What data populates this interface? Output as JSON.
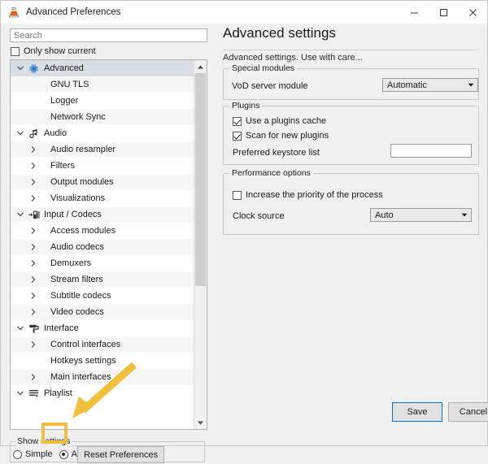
{
  "window": {
    "title": "Advanced Preferences",
    "icon": "vlc-cone-icon",
    "controls": {
      "minimize": "minimize-icon",
      "maximize": "maximize-icon",
      "close": "close-icon"
    }
  },
  "search": {
    "placeholder": "Search",
    "value": ""
  },
  "only_show_current": {
    "label": "Only show current",
    "checked": false
  },
  "tree": {
    "items": [
      {
        "label": "Advanced",
        "indent": 0,
        "icon": "gear-icon",
        "twisty": "expanded",
        "selected": true
      },
      {
        "label": "GNU TLS",
        "indent": 1,
        "icon": "none",
        "twisty": "none"
      },
      {
        "label": "Logger",
        "indent": 1,
        "icon": "none",
        "twisty": "none"
      },
      {
        "label": "Network Sync",
        "indent": 1,
        "icon": "none",
        "twisty": "none"
      },
      {
        "label": "Audio",
        "indent": 0,
        "icon": "music-note-icon",
        "twisty": "expanded"
      },
      {
        "label": "Audio resampler",
        "indent": 1,
        "icon": "none",
        "twisty": "collapsed"
      },
      {
        "label": "Filters",
        "indent": 1,
        "icon": "none",
        "twisty": "collapsed"
      },
      {
        "label": "Output modules",
        "indent": 1,
        "icon": "none",
        "twisty": "collapsed"
      },
      {
        "label": "Visualizations",
        "indent": 1,
        "icon": "none",
        "twisty": "collapsed"
      },
      {
        "label": "Input / Codecs",
        "indent": 0,
        "icon": "input-codecs-icon",
        "twisty": "expanded"
      },
      {
        "label": "Access modules",
        "indent": 1,
        "icon": "none",
        "twisty": "collapsed"
      },
      {
        "label": "Audio codecs",
        "indent": 1,
        "icon": "none",
        "twisty": "collapsed"
      },
      {
        "label": "Demuxers",
        "indent": 1,
        "icon": "none",
        "twisty": "collapsed"
      },
      {
        "label": "Stream filters",
        "indent": 1,
        "icon": "none",
        "twisty": "collapsed"
      },
      {
        "label": "Subtitle codecs",
        "indent": 1,
        "icon": "none",
        "twisty": "collapsed"
      },
      {
        "label": "Video codecs",
        "indent": 1,
        "icon": "none",
        "twisty": "collapsed"
      },
      {
        "label": "Interface",
        "indent": 0,
        "icon": "paint-roller-icon",
        "twisty": "expanded"
      },
      {
        "label": "Control interfaces",
        "indent": 1,
        "icon": "none",
        "twisty": "collapsed"
      },
      {
        "label": "Hotkeys settings",
        "indent": 1,
        "icon": "none",
        "twisty": "none"
      },
      {
        "label": "Main interfaces",
        "indent": 1,
        "icon": "none",
        "twisty": "collapsed"
      },
      {
        "label": "Playlist",
        "indent": 0,
        "icon": "playlist-icon",
        "twisty": "expanded"
      }
    ]
  },
  "scrollbar": {
    "up": "scroll-up-icon",
    "down": "scroll-down-icon"
  },
  "show_settings": {
    "group_label": "Show settings",
    "options": [
      {
        "label": "Simple",
        "selected": false
      },
      {
        "label": "All",
        "selected": true
      }
    ],
    "reset_button": "Reset Preferences"
  },
  "panel": {
    "heading": "Advanced settings",
    "description": "Advanced settings. Use with care...",
    "groups": [
      {
        "label": "Special modules",
        "fields": [
          {
            "type": "combo",
            "label": "VoD server module",
            "value": "Automatic"
          }
        ]
      },
      {
        "label": "Plugins",
        "fields": [
          {
            "type": "checkbox",
            "label": "Use a plugins cache",
            "checked": true
          },
          {
            "type": "checkbox",
            "label": "Scan for new plugins",
            "checked": true
          },
          {
            "type": "text",
            "label": "Preferred keystore list",
            "value": ""
          }
        ]
      },
      {
        "label": "Performance options",
        "fields": [
          {
            "type": "checkbox",
            "label": "Increase the priority of the process",
            "checked": false
          },
          {
            "type": "combo",
            "label": "Clock source",
            "value": "Auto"
          }
        ]
      }
    ]
  },
  "footer": {
    "save": "Save",
    "cancel": "Cancel"
  },
  "annotation": {
    "color": "#F0BF3C",
    "arrow": "down-left-arrow",
    "highlight_target": "All"
  }
}
